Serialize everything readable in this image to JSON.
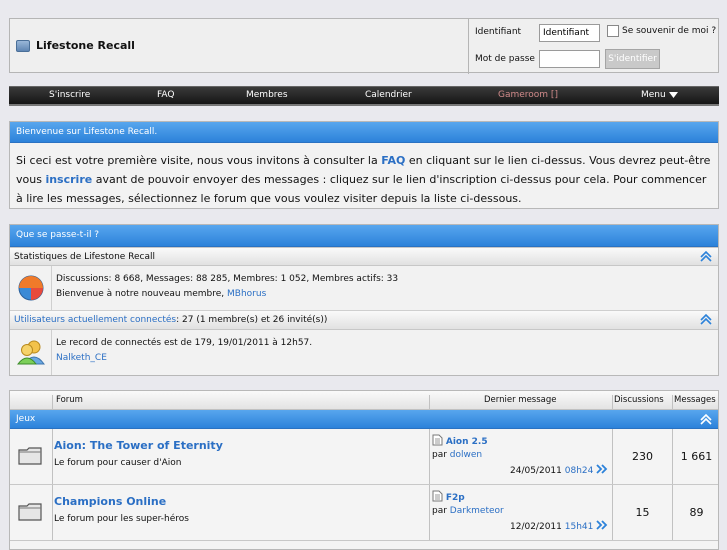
{
  "header": {
    "site_title": "Lifestone Recall",
    "login": {
      "username_label": "Identifiant",
      "username_value": "Identifiant",
      "password_label": "Mot de passe",
      "remember_label": "Se souvenir de moi ?",
      "submit_label": "S'identifier"
    }
  },
  "navbar": {
    "items": [
      "S'inscrire",
      "FAQ",
      "Membres",
      "Calendrier",
      "Gameroom []",
      "Menu"
    ]
  },
  "welcome": {
    "title": "Bienvenue sur Lifestone Recall.",
    "text_1": "Si ceci est votre première visite, nous vous invitons à consulter la ",
    "faq_link": "FAQ",
    "text_2": " en cliquant sur le lien ci-dessus. Vous devrez peut-être vous ",
    "register_link": "inscrire",
    "text_3": " avant de pouvoir envoyer des messages : cliquez sur le lien d'inscription ci-dessus pour cela. Pour commencer à lire les messages, sélectionnez le forum que vous voulez visiter depuis la liste ci-dessous."
  },
  "whats_going_on": {
    "title": "Que se passe-t-il ?",
    "stats_header": "Statistiques de Lifestone Recall",
    "stats_line": "Discussions: 8 668, Messages: 88 285, Membres: 1 052, Membres actifs: 33",
    "welcome_member_prefix": "Bienvenue à notre nouveau membre, ",
    "newest_member": "MBhorus",
    "online_link": "Utilisateurs actuellement connectés",
    "online_suffix": ": 27 (1 membre(s) et 26 invité(s))",
    "record_line": "Le record de connectés est de 179, 19/01/2011 à 12h57.",
    "online_user": "Nalketh_CE"
  },
  "forum_table": {
    "columns": {
      "forum": "Forum",
      "last_post": "Dernier message",
      "threads": "Discussions",
      "posts": "Messages"
    },
    "category": "Jeux",
    "forums": [
      {
        "name": "Aion: The Tower of Eternity",
        "description": "Le forum pour causer d'Aion",
        "last_title": "Aion 2.5",
        "by_prefix": "par ",
        "last_author": "dolwen",
        "last_date": "24/05/2011",
        "last_time": "08h24",
        "threads": "230",
        "posts": "1 661"
      },
      {
        "name": "Champions Online",
        "description": "Le forum pour les super-héros",
        "last_title": "F2p",
        "by_prefix": "par ",
        "last_author": "Darkmeteor",
        "last_date": "12/02/2011",
        "last_time": "15h41",
        "threads": "15",
        "posts": "89"
      }
    ]
  },
  "colors": {
    "accent_blue": "#2c82da",
    "link_blue": "#2b6fc4",
    "navbar_dark": "#151515"
  }
}
